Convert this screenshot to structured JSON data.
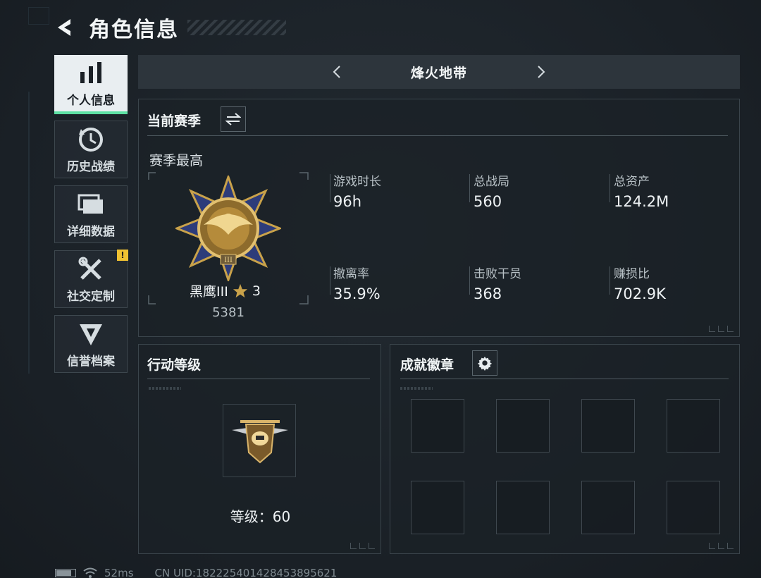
{
  "header": {
    "title": "角色信息"
  },
  "sidebar": {
    "items": [
      {
        "label": "个人信息",
        "icon": "bar-chart-icon",
        "active": true
      },
      {
        "label": "历史战绩",
        "icon": "history-icon"
      },
      {
        "label": "详细数据",
        "icon": "folders-icon"
      },
      {
        "label": "社交定制",
        "icon": "tools-icon",
        "badge": "!"
      },
      {
        "label": "信誉档案",
        "icon": "emblem-icon"
      }
    ]
  },
  "mode": {
    "title": "烽火地带"
  },
  "season": {
    "title": "当前赛季",
    "subtitle": "赛季最高",
    "rank_name": "黑鹰III",
    "rank_stars": "3",
    "rank_score": "5381",
    "stats": [
      {
        "label": "游戏时长",
        "value": "96h"
      },
      {
        "label": "总战局",
        "value": "560"
      },
      {
        "label": "总资产",
        "value": "124.2M"
      },
      {
        "label": "撤离率",
        "value": "35.9%"
      },
      {
        "label": "击败干员",
        "value": "368"
      },
      {
        "label": "赚损比",
        "value": "702.9K"
      }
    ]
  },
  "action_level": {
    "title": "行动等级",
    "level_text": "等级：60"
  },
  "achievements": {
    "title": "成就徽章"
  },
  "footer": {
    "ping": "52ms",
    "uid": "CN UID:18222540142845389​5621"
  },
  "colors": {
    "accent": "#5de0a3",
    "alert": "#f1c232",
    "gold": "#c9a24a"
  }
}
